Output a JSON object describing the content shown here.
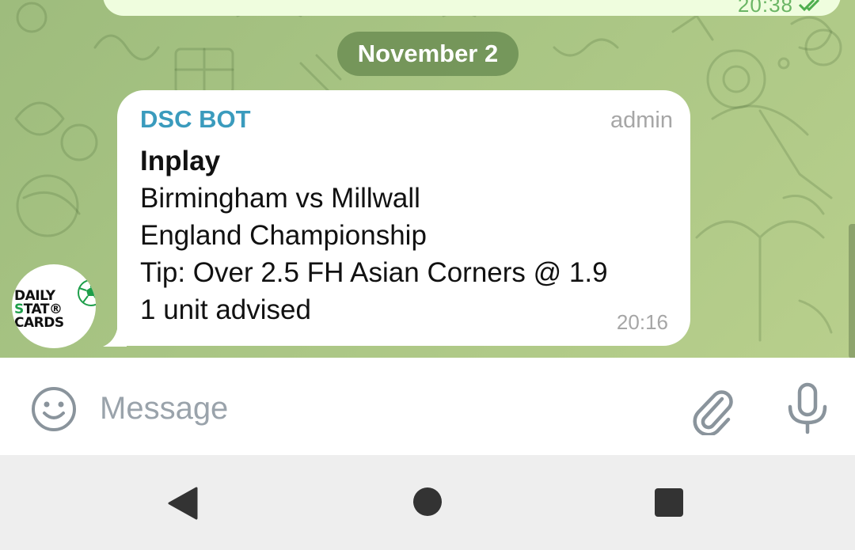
{
  "previous_message": {
    "time": "20:38"
  },
  "date_separator": "November 2",
  "message": {
    "sender": "DSC BOT",
    "role": "admin",
    "lines": [
      "Inplay",
      "Birmingham vs Millwall",
      "England Championship",
      "Tip: Over 2.5 FH Asian Corners @ 1.9",
      "1 unit advised"
    ],
    "time": "20:16",
    "avatar": {
      "logo_lines": [
        "DAILY",
        "STAT®",
        "CARDS"
      ]
    }
  },
  "input_bar": {
    "placeholder": "Message",
    "value": ""
  },
  "icons": {
    "emoji": "emoji-smile-icon",
    "attach": "paperclip-icon",
    "mic": "microphone-icon",
    "read": "double-check-icon",
    "nav_back": "back-triangle-icon",
    "nav_home": "home-circle-icon",
    "nav_recents": "recents-square-icon"
  },
  "colors": {
    "sender": "#3a9bbd",
    "date_pill": "#6c8e54",
    "outgoing_bubble": "#effdde",
    "read_check": "#4fae4e"
  }
}
